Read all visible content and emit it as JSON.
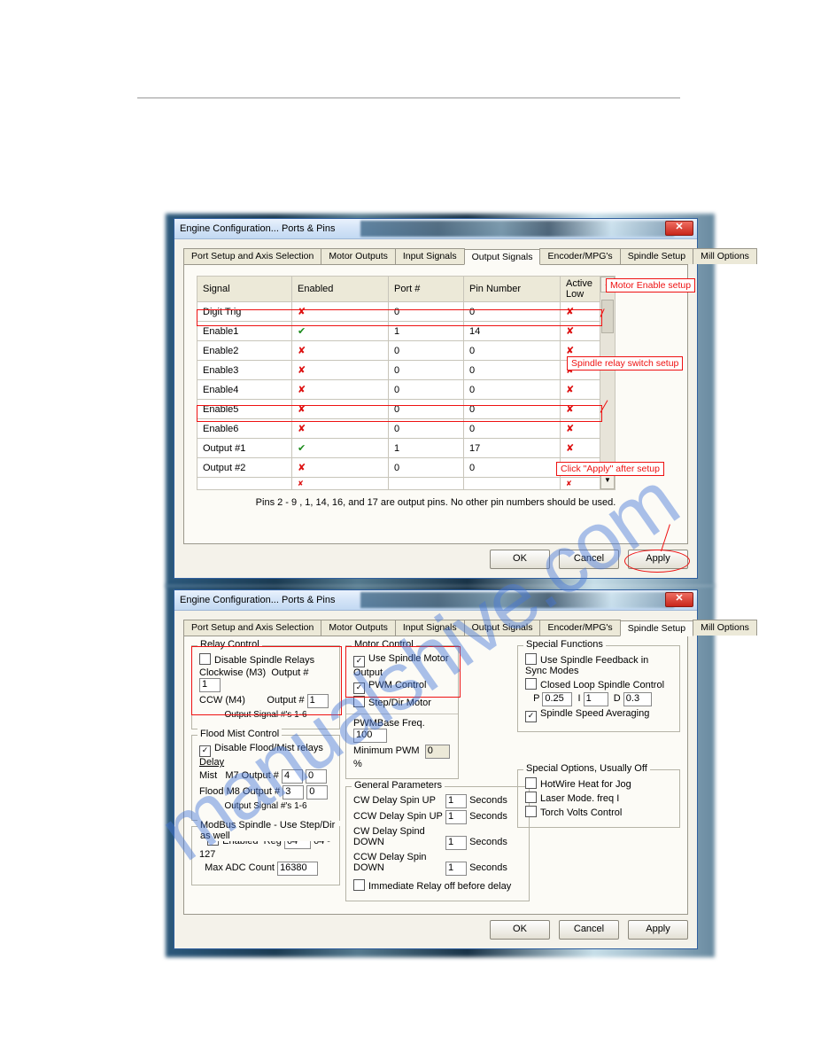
{
  "dialog_title": "Engine Configuration... Ports & Pins",
  "tabs": [
    "Port Setup and Axis Selection",
    "Motor Outputs",
    "Input Signals",
    "Output Signals",
    "Encoder/MPG's",
    "Spindle Setup",
    "Mill Options"
  ],
  "active_tab_d1": "Output Signals",
  "active_tab_d2": "Spindle Setup",
  "table_headers": [
    "Signal",
    "Enabled",
    "Port #",
    "Pin Number",
    "Active Low"
  ],
  "rows": [
    {
      "signal": "Digit Trig",
      "enabled": false,
      "port": "0",
      "pin": "0",
      "active_low": false
    },
    {
      "signal": "Enable1",
      "enabled": true,
      "port": "1",
      "pin": "14",
      "active_low": false
    },
    {
      "signal": "Enable2",
      "enabled": false,
      "port": "0",
      "pin": "0",
      "active_low": false
    },
    {
      "signal": "Enable3",
      "enabled": false,
      "port": "0",
      "pin": "0",
      "active_low": false
    },
    {
      "signal": "Enable4",
      "enabled": false,
      "port": "0",
      "pin": "0",
      "active_low": false
    },
    {
      "signal": "Enable5",
      "enabled": false,
      "port": "0",
      "pin": "0",
      "active_low": false
    },
    {
      "signal": "Enable6",
      "enabled": false,
      "port": "0",
      "pin": "0",
      "active_low": false
    },
    {
      "signal": "Output #1",
      "enabled": true,
      "port": "1",
      "pin": "17",
      "active_low": false
    },
    {
      "signal": "Output #2",
      "enabled": false,
      "port": "0",
      "pin": "0",
      "active_low": false
    }
  ],
  "last_partial_row": {
    "signal": "",
    "enabled": false,
    "port": "",
    "pin": "",
    "active_low": false
  },
  "pins_note": "Pins 2 - 9 , 1, 14, 16, and 17 are output pins. No other pin numbers should be used.",
  "buttons": {
    "ok": "OK",
    "cancel": "Cancel",
    "apply": "Apply"
  },
  "annotations": {
    "motor_enable": "Motor Enable setup",
    "spindle_relay": "Spindle relay switch setup",
    "click_apply": "Click \"Apply\" after setup"
  },
  "relay_control": {
    "legend": "Relay Control",
    "disable_relays": "Disable Spindle Relays",
    "cw_label": "Clockwise (M3)",
    "ccw_label": "CCW (M4)",
    "output_num": "Output #",
    "cw_val": "1",
    "ccw_val": "1",
    "note": "Output Signal #'s 1-6"
  },
  "motor_control": {
    "legend": "Motor Control",
    "use_spindle": "Use Spindle Motor Output",
    "pwm_control": "PWM Control",
    "step_dir": "Step/Dir Motor",
    "pwm_base_label": "PWMBase Freq.",
    "pwm_base_val": "100",
    "min_pwm_label": "Minimum PWM",
    "min_pwm_val": "0",
    "pct": "%"
  },
  "special_functions": {
    "legend": "Special Functions",
    "use_feedback": "Use Spindle Feedback in Sync Modes",
    "closed_loop": "Closed Loop Spindle Control",
    "p_label": "P",
    "p_val": "0.25",
    "i_label": "I",
    "i_val": "1",
    "d_label": "D",
    "d_val": "0.3",
    "speed_avg": "Spindle Speed Averaging"
  },
  "flood_mist": {
    "legend": "Flood Mist Control",
    "disable_fm": "Disable Flood/Mist relays",
    "delay_label": "Delay",
    "mist_label": "Mist",
    "mist_m": "M7 Output #",
    "mist_v1": "4",
    "mist_v2": "0",
    "flood_label": "Flood",
    "flood_m": "M8 Output #",
    "flood_v1": "3",
    "flood_v2": "0",
    "note": "Output Signal #'s 1-6"
  },
  "general_params": {
    "legend": "General Parameters",
    "r1": "CW Delay Spin UP",
    "v1": "1",
    "r2": "CCW Delay Spin UP",
    "v2": "1",
    "r3": "CW Delay Spind DOWN",
    "v3": "1",
    "r4": "CCW Delay Spin DOWN",
    "v4": "1",
    "seconds": "Seconds",
    "immediate": "Immediate Relay off before delay"
  },
  "modbus": {
    "legend": "ModBus Spindle - Use Step/Dir as well",
    "enabled": "Enabled",
    "reg_label": "Reg",
    "reg_val": "64",
    "reg_range": "64 - 127",
    "max_adc_label": "Max ADC Count",
    "max_adc_val": "16380"
  },
  "special_options": {
    "legend": "Special Options, Usually Off",
    "hotwire": "HotWire Heat for Jog",
    "laser": "Laser Mode. freq I",
    "torch": "Torch Volts Control"
  },
  "watermark": "manualshive.com"
}
